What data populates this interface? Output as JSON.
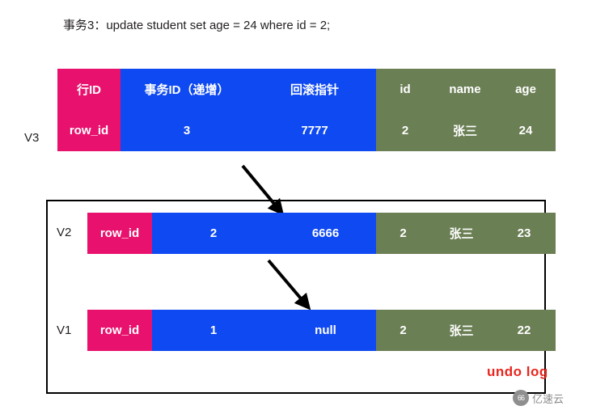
{
  "caption": "事务3：update student set age = 24 where id = 2;",
  "colors": {
    "pink": "#e8126e",
    "blue": "#0f49f1",
    "green": "#6b7f55",
    "undo_red": "#e8261e",
    "box_border": "#000000",
    "arrow": "#000000"
  },
  "headers": [
    "行ID",
    "事务ID（递增）",
    "回滚指针",
    "id",
    "name",
    "age"
  ],
  "rows": [
    {
      "label": "V3",
      "cells": [
        "row_id",
        "3",
        "7777",
        "2",
        "张三",
        "24"
      ]
    },
    {
      "label": "V2",
      "cells": [
        "row_id",
        "2",
        "6666",
        "2",
        "张三",
        "23"
      ]
    },
    {
      "label": "V1",
      "cells": [
        "row_id",
        "1",
        "null",
        "2",
        "张三",
        "22"
      ]
    }
  ],
  "undo_log_label": "undo log",
  "watermark": {
    "logo": "66",
    "text": "亿速云"
  }
}
